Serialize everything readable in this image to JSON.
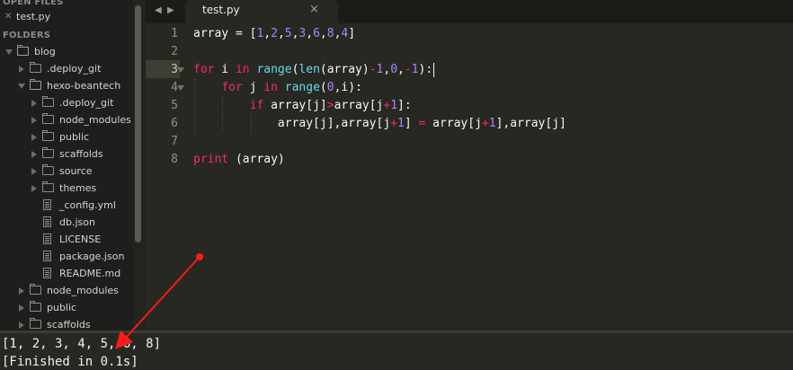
{
  "sidebar": {
    "open_files_header": "OPEN FILES",
    "open_file": "test.py",
    "folders_header": "FOLDERS",
    "tree": [
      {
        "label": "blog",
        "kind": "folder",
        "open": true,
        "depth": 0
      },
      {
        "label": ".deploy_git",
        "kind": "folder",
        "open": false,
        "depth": 1
      },
      {
        "label": "hexo-beantech",
        "kind": "folder",
        "open": true,
        "depth": 1
      },
      {
        "label": ".deploy_git",
        "kind": "folder",
        "open": false,
        "depth": 2
      },
      {
        "label": "node_modules",
        "kind": "folder",
        "open": false,
        "depth": 2
      },
      {
        "label": "public",
        "kind": "folder",
        "open": false,
        "depth": 2
      },
      {
        "label": "scaffolds",
        "kind": "folder",
        "open": false,
        "depth": 2
      },
      {
        "label": "source",
        "kind": "folder",
        "open": false,
        "depth": 2
      },
      {
        "label": "themes",
        "kind": "folder",
        "open": false,
        "depth": 2
      },
      {
        "label": "_config.yml",
        "kind": "file",
        "depth": 2
      },
      {
        "label": "db.json",
        "kind": "file",
        "depth": 2
      },
      {
        "label": "LICENSE",
        "kind": "file",
        "depth": 2
      },
      {
        "label": "package.json",
        "kind": "file",
        "depth": 2
      },
      {
        "label": "README.md",
        "kind": "file",
        "depth": 2
      },
      {
        "label": "node_modules",
        "kind": "folder",
        "open": false,
        "depth": 1
      },
      {
        "label": "public",
        "kind": "folder",
        "open": false,
        "depth": 1
      },
      {
        "label": "scaffolds",
        "kind": "folder",
        "open": false,
        "depth": 1
      }
    ]
  },
  "tabs": {
    "active_label": "test.py",
    "close_glyph": "×",
    "nav_left_glyph": "◀",
    "nav_right_glyph": "▶"
  },
  "editor": {
    "line_numbers": [
      "1",
      "2",
      "3",
      "4",
      "5",
      "6",
      "7",
      "8"
    ],
    "current_line": "3",
    "lines": [
      [
        {
          "t": "array = [",
          "c": ""
        },
        {
          "t": "1",
          "c": "num"
        },
        {
          "t": ",",
          "c": ""
        },
        {
          "t": "2",
          "c": "num"
        },
        {
          "t": ",",
          "c": ""
        },
        {
          "t": "5",
          "c": "num"
        },
        {
          "t": ",",
          "c": ""
        },
        {
          "t": "3",
          "c": "num"
        },
        {
          "t": ",",
          "c": ""
        },
        {
          "t": "6",
          "c": "num"
        },
        {
          "t": ",",
          "c": ""
        },
        {
          "t": "8",
          "c": "num"
        },
        {
          "t": ",",
          "c": ""
        },
        {
          "t": "4",
          "c": "num"
        },
        {
          "t": "]",
          "c": ""
        }
      ],
      [],
      [
        {
          "t": "for",
          "c": "kw"
        },
        {
          "t": " i ",
          "c": ""
        },
        {
          "t": "in",
          "c": "kw"
        },
        {
          "t": " ",
          "c": ""
        },
        {
          "t": "range",
          "c": "bi"
        },
        {
          "t": "(",
          "c": ""
        },
        {
          "t": "len",
          "c": "bi"
        },
        {
          "t": "(array)",
          "c": ""
        },
        {
          "t": "-",
          "c": "op"
        },
        {
          "t": "1",
          "c": "num"
        },
        {
          "t": ",",
          "c": ""
        },
        {
          "t": "0",
          "c": "num"
        },
        {
          "t": ",",
          "c": ""
        },
        {
          "t": "-",
          "c": "op"
        },
        {
          "t": "1",
          "c": "num"
        },
        {
          "t": "):",
          "c": ""
        }
      ],
      [
        {
          "t": "    ",
          "c": ""
        },
        {
          "t": "for",
          "c": "kw"
        },
        {
          "t": " j ",
          "c": ""
        },
        {
          "t": "in",
          "c": "kw"
        },
        {
          "t": " ",
          "c": ""
        },
        {
          "t": "range",
          "c": "bi"
        },
        {
          "t": "(",
          "c": ""
        },
        {
          "t": "0",
          "c": "num"
        },
        {
          "t": ",i):",
          "c": ""
        }
      ],
      [
        {
          "t": "        ",
          "c": ""
        },
        {
          "t": "if",
          "c": "kw"
        },
        {
          "t": " array[j]",
          "c": ""
        },
        {
          "t": ">",
          "c": "op"
        },
        {
          "t": "array[j",
          "c": ""
        },
        {
          "t": "+",
          "c": "op"
        },
        {
          "t": "1",
          "c": "num"
        },
        {
          "t": "]:",
          "c": ""
        }
      ],
      [
        {
          "t": "            array[j],array[j",
          "c": ""
        },
        {
          "t": "+",
          "c": "op"
        },
        {
          "t": "1",
          "c": "num"
        },
        {
          "t": "] ",
          "c": ""
        },
        {
          "t": "=",
          "c": "op"
        },
        {
          "t": " array[j",
          "c": ""
        },
        {
          "t": "+",
          "c": "op"
        },
        {
          "t": "1",
          "c": "num"
        },
        {
          "t": "],array[j]",
          "c": ""
        }
      ],
      [],
      [
        {
          "t": "print",
          "c": "kw"
        },
        {
          "t": " (array)",
          "c": ""
        }
      ]
    ]
  },
  "console": {
    "output_line": "[1, 2, 3, 4, 5, 6, 8]",
    "status_line": "[Finished in 0.1s]"
  },
  "colors": {
    "keyword": "#f92672",
    "builtin": "#66d9ef",
    "number": "#ae81ff",
    "annotation_arrow": "#ff1a1a"
  }
}
